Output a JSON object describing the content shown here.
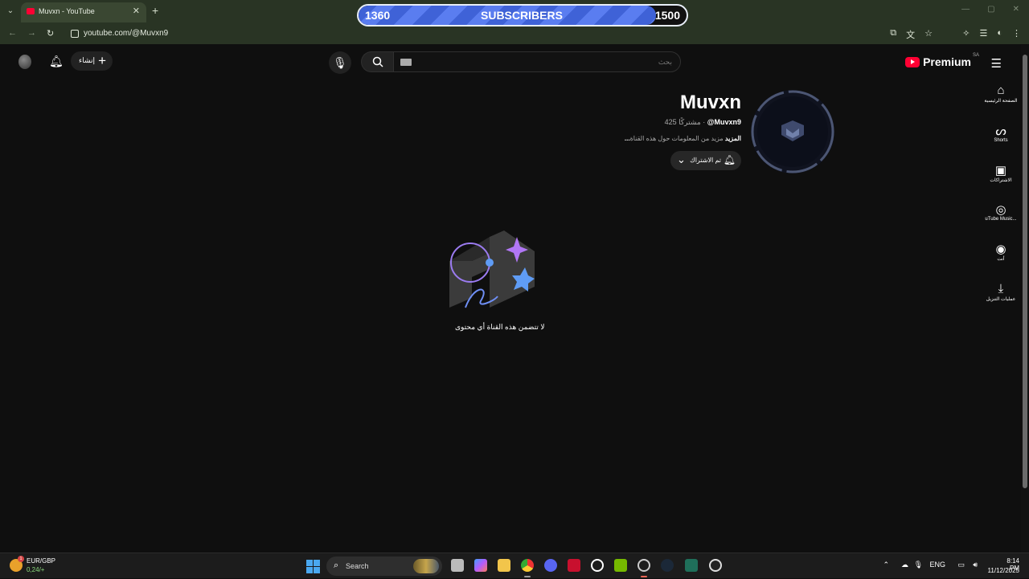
{
  "browser": {
    "tab_title": "Muvxn - YouTube",
    "url": "youtube.com/@Muvxn9"
  },
  "subscriber_goal": {
    "current": "1360",
    "label": "SUBSCRIBERS",
    "goal": "1500",
    "progress_fraction": 0.907
  },
  "youtube": {
    "create_label": "إنشاء",
    "search_placeholder": "بحث",
    "logo_text": "Premium",
    "region": "SA",
    "guide": [
      {
        "icon": "home-icon",
        "label": "الصفحة الرئيسية"
      },
      {
        "icon": "shorts-icon",
        "label": "Shorts"
      },
      {
        "icon": "subscriptions-icon",
        "label": "الاشتراكات"
      },
      {
        "icon": "youtube-music-icon",
        "label": "uTube Music..."
      },
      {
        "icon": "you-icon",
        "label": "أنت"
      },
      {
        "icon": "downloads-icon",
        "label": "عمليات التنزيل"
      }
    ],
    "channel": {
      "name": "Muvxn",
      "handle": "@Muvxn9",
      "subscribers": "425 مشتركًا",
      "separator": "·",
      "description": "مزيد من المعلومات حول هذه القناة",
      "more_label": "...المزيد",
      "subscribe_label": "تم الاشتراك"
    },
    "empty_message": "لا تتضمن هذه القناة أي محتوى"
  },
  "taskbar": {
    "widget_pair": "EUR/GBP",
    "widget_value": "0,24/+",
    "widget_badge": "1",
    "search_label": "Search",
    "lang": "ENG",
    "time": "8:14 PM",
    "date": "11/12/2025"
  }
}
